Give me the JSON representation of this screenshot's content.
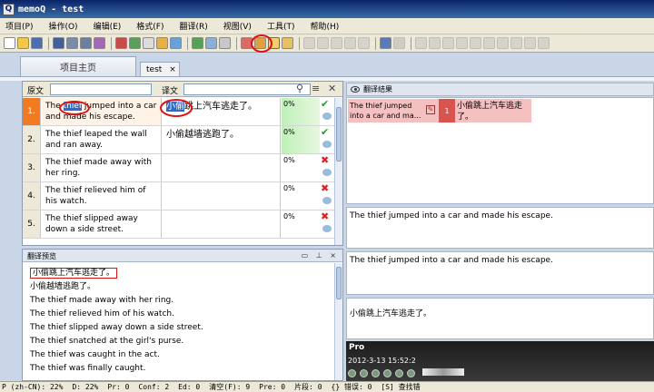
{
  "window": {
    "title": "memoQ - test"
  },
  "menu": [
    "项目(P)",
    "操作(O)",
    "编辑(E)",
    "格式(F)",
    "翻译(R)",
    "视图(V)",
    "工具(T)",
    "帮助(H)"
  ],
  "tabs": {
    "home": "项目主页",
    "document": "test",
    "close": "×"
  },
  "filter": {
    "source_label": "原文",
    "target_label": "译文",
    "source_value": "",
    "target_value": ""
  },
  "segments": [
    {
      "num": "1.",
      "source_pre": "The ",
      "source_hl": "thief",
      "source_post": " jumped into a car and made his escape.",
      "target_hl": "小偷",
      "target_post": "跳上汽车逃走了。",
      "status": "0%",
      "confirmed": true
    },
    {
      "num": "2.",
      "source_pre": "The thief leaped the wall and ran away.",
      "source_hl": "",
      "source_post": "",
      "target_hl": "",
      "target_post": "小偷越墙逃跑了。",
      "status": "0%",
      "confirmed": true
    },
    {
      "num": "3.",
      "source_pre": "The thief made away with her ring.",
      "source_hl": "",
      "source_post": "",
      "target_hl": "",
      "target_post": "",
      "status": "0%",
      "confirmed": false
    },
    {
      "num": "4.",
      "source_pre": "The thief relieved him of his watch.",
      "source_hl": "",
      "source_post": "",
      "target_hl": "",
      "target_post": "",
      "status": "0%",
      "confirmed": false
    },
    {
      "num": "5.",
      "source_pre": "The thief slipped away down a side street.",
      "source_hl": "",
      "source_post": "",
      "target_hl": "",
      "target_post": "",
      "status": "0%",
      "confirmed": false
    }
  ],
  "preview": {
    "title": "翻译预览",
    "controls": "▭ ⊥ ×",
    "lines": [
      "小偷跳上汽车逃走了。",
      "小偷越墙逃跑了。",
      "The thief made away with her ring.",
      "The thief relieved him of his watch.",
      "The thief slipped away down a side street.",
      "The thief snatched at the girl's purse.",
      "The thief was caught in the act.",
      "The thief was finally caught."
    ]
  },
  "results": {
    "title": "翻译结果",
    "match": {
      "source": "The thief jumped into a car and ma...",
      "num": "1",
      "target": "小偷跳上汽车逃走了。"
    },
    "box_source": "The thief jumped into a car and made his escape.",
    "box_compare": "The thief jumped into a car and made his escape.",
    "box_target": "小偷跳上汽车逃走了。"
  },
  "pro": {
    "title": "Pro",
    "date": "2012-3-13 15:52:2"
  },
  "status": {
    "items": [
      "P (zh-CN): 22%",
      "D: 22%",
      "Pr: 0",
      "Conf: 2",
      "Ed: 0",
      "清空(F): 9",
      "Pre: 0",
      "片段: 0",
      "{} 错误: 0",
      "[S] 查找错"
    ]
  },
  "colors": {
    "active_row": "#f27a21",
    "accent_circle": "#dd1111",
    "selection": "#316ac5",
    "match_bg": "#f5c0c0"
  }
}
